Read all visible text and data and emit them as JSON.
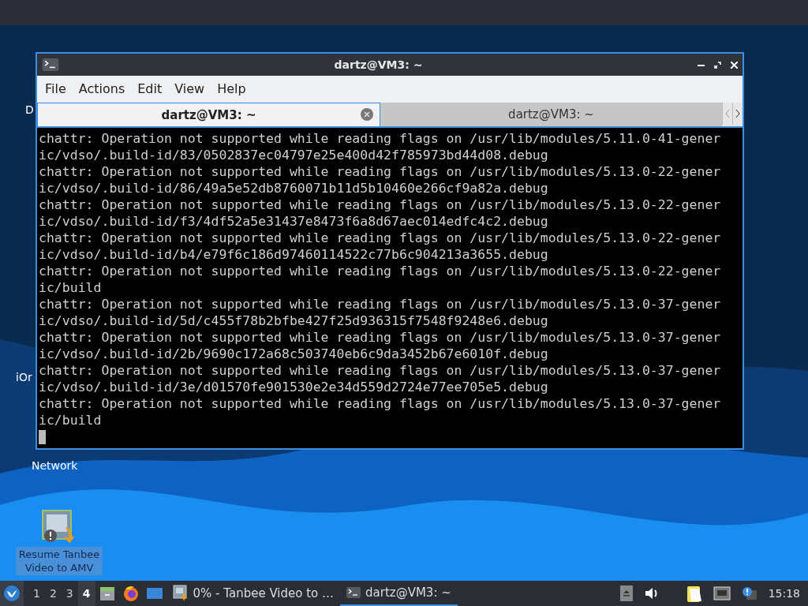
{
  "desktop": {
    "icons": [
      {
        "kind": "label",
        "label": "D",
        "selected": false
      },
      {
        "kind": "label",
        "label": "iOr",
        "selected": false
      },
      {
        "kind": "label",
        "label": "Network",
        "selected": false
      },
      {
        "kind": "app",
        "label": "Resume Tanbee Video to AMV",
        "selected": true
      }
    ]
  },
  "window": {
    "title": "dartz@VM3: ~",
    "menu": [
      "File",
      "Actions",
      "Edit",
      "View",
      "Help"
    ],
    "tabs": [
      {
        "label": "dartz@VM3: ~",
        "selected": true
      },
      {
        "label": "dartz@VM3: ~",
        "selected": false
      }
    ],
    "terminal": {
      "lines": [
        "chattr: Operation not supported while reading flags on /usr/lib/modules/5.11.0-41-gener",
        "ic/vdso/.build-id/83/0502837ec04797e25e400d42f785973bd44d08.debug",
        "chattr: Operation not supported while reading flags on /usr/lib/modules/5.13.0-22-gener",
        "ic/vdso/.build-id/86/49a5e52db8760071b11d5b10460e266cf9a82a.debug",
        "chattr: Operation not supported while reading flags on /usr/lib/modules/5.13.0-22-gener",
        "ic/vdso/.build-id/f3/4df52a5e31437e8473f6a8d67aec014edfc4c2.debug",
        "chattr: Operation not supported while reading flags on /usr/lib/modules/5.13.0-22-gener",
        "ic/vdso/.build-id/b4/e79f6c186d97460114522c77b6c904213a3655.debug",
        "chattr: Operation not supported while reading flags on /usr/lib/modules/5.13.0-22-gener",
        "ic/build",
        "chattr: Operation not supported while reading flags on /usr/lib/modules/5.13.0-37-gener",
        "ic/vdso/.build-id/5d/c455f78b2bfbe427f25d936315f7548f9248e6.debug",
        "chattr: Operation not supported while reading flags on /usr/lib/modules/5.13.0-37-gener",
        "ic/vdso/.build-id/2b/9690c172a68c503740eb6c9da3452b67e6010f.debug",
        "chattr: Operation not supported while reading flags on /usr/lib/modules/5.13.0-37-gener",
        "ic/vdso/.build-id/3e/d01570fe901530e2e34d559d2724e77ee705e5.debug",
        "chattr: Operation not supported while reading flags on /usr/lib/modules/5.13.0-37-gener",
        "ic/build"
      ],
      "cursor": true
    }
  },
  "taskbar": {
    "workspaces": [
      {
        "label": "1",
        "selected": false
      },
      {
        "label": "2",
        "selected": false
      },
      {
        "label": "3",
        "selected": false
      },
      {
        "label": "4",
        "selected": true
      }
    ],
    "tasks": [
      {
        "label": "0% - Tanbee Video to …",
        "kind": "app",
        "selected": false
      },
      {
        "label": "dartz@VM3: ~",
        "kind": "terminal",
        "selected": true
      }
    ],
    "clock": "15:18"
  }
}
